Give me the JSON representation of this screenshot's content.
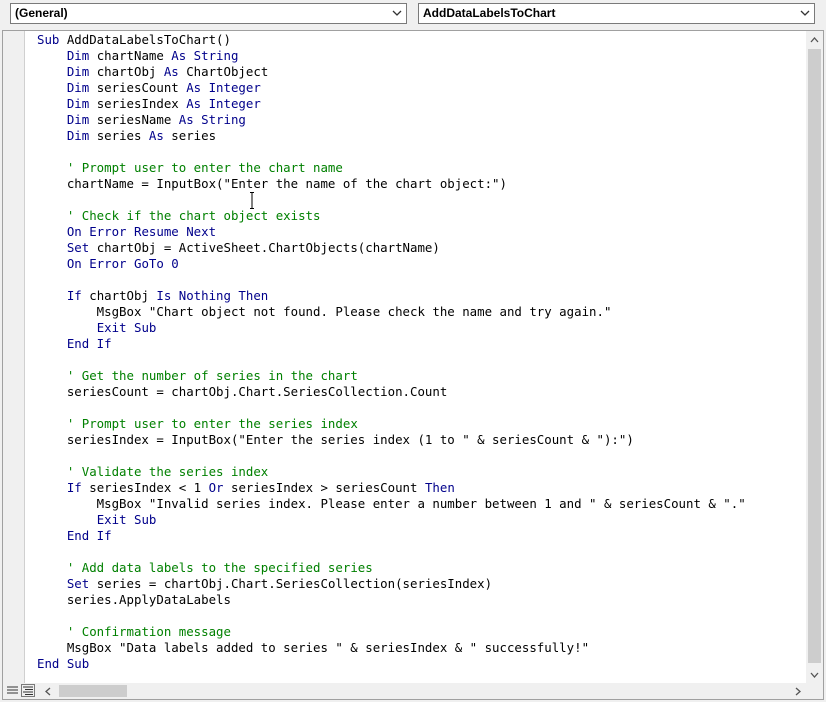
{
  "toolbar": {
    "object_combo": "(General)",
    "procedure_combo": "AddDataLabelsToChart"
  },
  "code_lines": [
    [
      {
        "t": "Sub ",
        "c": "kw"
      },
      {
        "t": "AddDataLabelsToChart()",
        "c": ""
      }
    ],
    [
      {
        "t": "    ",
        "c": ""
      },
      {
        "t": "Dim ",
        "c": "kw"
      },
      {
        "t": "chartName ",
        "c": ""
      },
      {
        "t": "As String",
        "c": "kw"
      }
    ],
    [
      {
        "t": "    ",
        "c": ""
      },
      {
        "t": "Dim ",
        "c": "kw"
      },
      {
        "t": "chartObj ",
        "c": ""
      },
      {
        "t": "As ",
        "c": "kw"
      },
      {
        "t": "ChartObject",
        "c": ""
      }
    ],
    [
      {
        "t": "    ",
        "c": ""
      },
      {
        "t": "Dim ",
        "c": "kw"
      },
      {
        "t": "seriesCount ",
        "c": ""
      },
      {
        "t": "As Integer",
        "c": "kw"
      }
    ],
    [
      {
        "t": "    ",
        "c": ""
      },
      {
        "t": "Dim ",
        "c": "kw"
      },
      {
        "t": "seriesIndex ",
        "c": ""
      },
      {
        "t": "As Integer",
        "c": "kw"
      }
    ],
    [
      {
        "t": "    ",
        "c": ""
      },
      {
        "t": "Dim ",
        "c": "kw"
      },
      {
        "t": "seriesName ",
        "c": ""
      },
      {
        "t": "As String",
        "c": "kw"
      }
    ],
    [
      {
        "t": "    ",
        "c": ""
      },
      {
        "t": "Dim ",
        "c": "kw"
      },
      {
        "t": "series ",
        "c": ""
      },
      {
        "t": "As ",
        "c": "kw"
      },
      {
        "t": "series",
        "c": ""
      }
    ],
    [],
    [
      {
        "t": "    ",
        "c": ""
      },
      {
        "t": "' Prompt user to enter the chart name",
        "c": "cm"
      }
    ],
    [
      {
        "t": "    chartName = InputBox(\"Enter the name of the chart object:\")",
        "c": ""
      }
    ],
    [],
    [
      {
        "t": "    ",
        "c": ""
      },
      {
        "t": "' Check if the chart object exists",
        "c": "cm"
      }
    ],
    [
      {
        "t": "    ",
        "c": ""
      },
      {
        "t": "On Error Resume Next",
        "c": "kw"
      }
    ],
    [
      {
        "t": "    ",
        "c": ""
      },
      {
        "t": "Set ",
        "c": "kw"
      },
      {
        "t": "chartObj = ActiveSheet.ChartObjects(chartName)",
        "c": ""
      }
    ],
    [
      {
        "t": "    ",
        "c": ""
      },
      {
        "t": "On Error GoTo 0",
        "c": "kw"
      }
    ],
    [],
    [
      {
        "t": "    ",
        "c": ""
      },
      {
        "t": "If ",
        "c": "kw"
      },
      {
        "t": "chartObj ",
        "c": ""
      },
      {
        "t": "Is Nothing Then",
        "c": "kw"
      }
    ],
    [
      {
        "t": "        MsgBox \"Chart object not found. Please check the name and try again.\"",
        "c": ""
      }
    ],
    [
      {
        "t": "        ",
        "c": ""
      },
      {
        "t": "Exit Sub",
        "c": "kw"
      }
    ],
    [
      {
        "t": "    ",
        "c": ""
      },
      {
        "t": "End If",
        "c": "kw"
      }
    ],
    [],
    [
      {
        "t": "    ",
        "c": ""
      },
      {
        "t": "' Get the number of series in the chart",
        "c": "cm"
      }
    ],
    [
      {
        "t": "    seriesCount = chartObj.Chart.SeriesCollection.Count",
        "c": ""
      }
    ],
    [],
    [
      {
        "t": "    ",
        "c": ""
      },
      {
        "t": "' Prompt user to enter the series index",
        "c": "cm"
      }
    ],
    [
      {
        "t": "    seriesIndex = InputBox(\"Enter the series index (1 to \" & seriesCount & \"):\")",
        "c": ""
      }
    ],
    [],
    [
      {
        "t": "    ",
        "c": ""
      },
      {
        "t": "' Validate the series index",
        "c": "cm"
      }
    ],
    [
      {
        "t": "    ",
        "c": ""
      },
      {
        "t": "If ",
        "c": "kw"
      },
      {
        "t": "seriesIndex < 1 ",
        "c": ""
      },
      {
        "t": "Or ",
        "c": "kw"
      },
      {
        "t": "seriesIndex > seriesCount ",
        "c": ""
      },
      {
        "t": "Then",
        "c": "kw"
      }
    ],
    [
      {
        "t": "        MsgBox \"Invalid series index. Please enter a number between 1 and \" & seriesCount & \".\"",
        "c": ""
      }
    ],
    [
      {
        "t": "        ",
        "c": ""
      },
      {
        "t": "Exit Sub",
        "c": "kw"
      }
    ],
    [
      {
        "t": "    ",
        "c": ""
      },
      {
        "t": "End If",
        "c": "kw"
      }
    ],
    [],
    [
      {
        "t": "    ",
        "c": ""
      },
      {
        "t": "' Add data labels to the specified series",
        "c": "cm"
      }
    ],
    [
      {
        "t": "    ",
        "c": ""
      },
      {
        "t": "Set ",
        "c": "kw"
      },
      {
        "t": "series = chartObj.Chart.SeriesCollection(seriesIndex)",
        "c": ""
      }
    ],
    [
      {
        "t": "    series.ApplyDataLabels",
        "c": ""
      }
    ],
    [],
    [
      {
        "t": "    ",
        "c": ""
      },
      {
        "t": "' Confirmation message",
        "c": "cm"
      }
    ],
    [
      {
        "t": "    MsgBox \"Data labels added to series \" & seriesIndex & \" successfully!\"",
        "c": ""
      }
    ],
    [
      {
        "t": "End Sub",
        "c": "kw"
      }
    ]
  ],
  "colors": {
    "keyword": "#00008b",
    "comment": "#008000",
    "text": "#000000"
  },
  "icons": {
    "object_dropdown": "chevron-down-icon",
    "procedure_dropdown": "chevron-down-icon",
    "procedure_view": "procedure-view-icon",
    "full_module_view": "full-module-view-icon"
  }
}
